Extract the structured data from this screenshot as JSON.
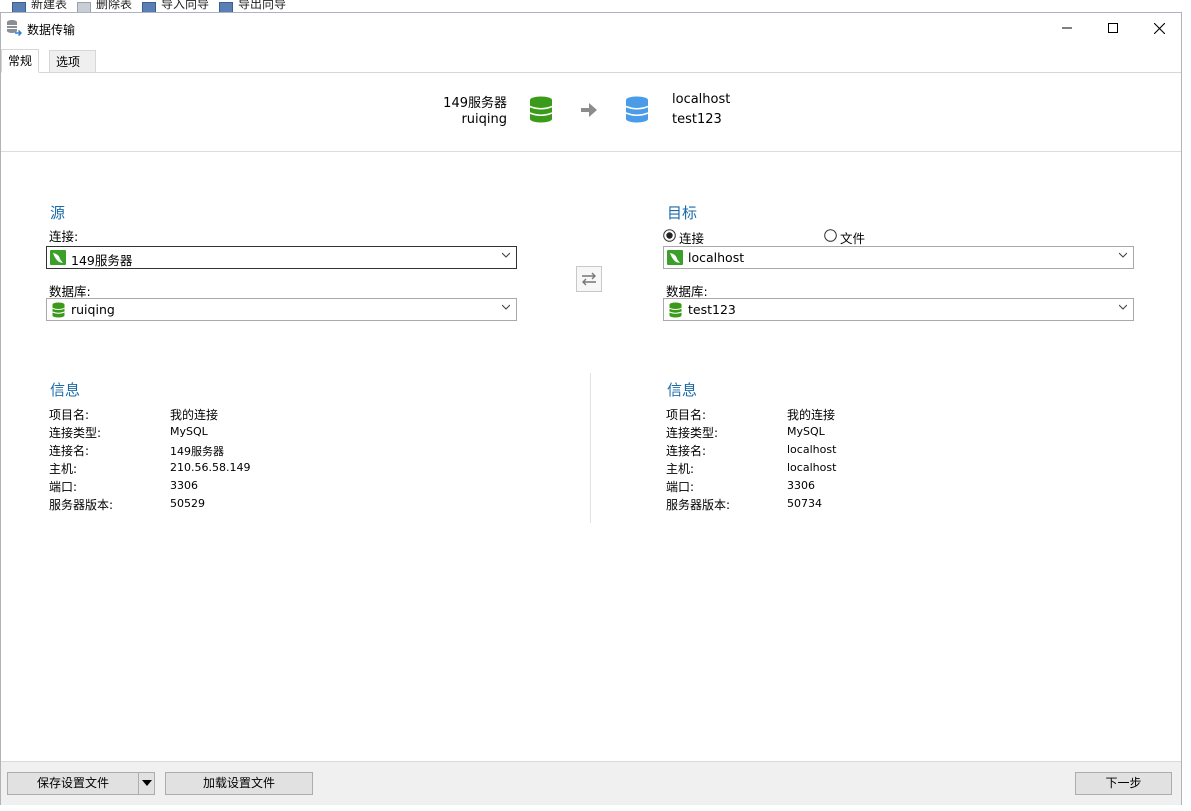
{
  "background_toolbar": {
    "items": [
      "新建表",
      "删除表",
      "导入向导",
      "导出向导"
    ]
  },
  "window": {
    "title": "数据传输",
    "controls": {
      "minimize": "—",
      "maximize": "☐",
      "close": "✕"
    }
  },
  "tabs": [
    {
      "label": "常规",
      "active": true
    },
    {
      "label": "选项",
      "active": false
    }
  ],
  "transfer_summary": {
    "source_connection": "149服务器",
    "source_database": "ruiqing",
    "target_connection": "localhost",
    "target_database": "test123",
    "source_icon": "green-database-icon",
    "target_icon": "blue-database-icon",
    "arrow_icon": "right-arrow-icon"
  },
  "source": {
    "title": "源",
    "connection_label": "连接:",
    "connection_value": "149服务器",
    "database_label": "数据库:",
    "database_value": "ruiqing"
  },
  "target": {
    "title": "目标",
    "radio_connection": "连接",
    "radio_file": "文件",
    "selected_radio": "connection",
    "connection_value": "localhost",
    "database_label": "数据库:",
    "database_value": "test123"
  },
  "swap_button_icon": "swap-arrows-icon",
  "source_info": {
    "title": "信息",
    "rows": [
      {
        "label": "项目名:",
        "value": "我的连接"
      },
      {
        "label": "连接类型:",
        "value": "MySQL"
      },
      {
        "label": "连接名:",
        "value": "149服务器"
      },
      {
        "label": "主机:",
        "value": "210.56.58.149"
      },
      {
        "label": "端口:",
        "value": "3306"
      },
      {
        "label": "服务器版本:",
        "value": "50529"
      }
    ]
  },
  "target_info": {
    "title": "信息",
    "rows": [
      {
        "label": "项目名:",
        "value": "我的连接"
      },
      {
        "label": "连接类型:",
        "value": "MySQL"
      },
      {
        "label": "连接名:",
        "value": "localhost"
      },
      {
        "label": "主机:",
        "value": "localhost"
      },
      {
        "label": "端口:",
        "value": "3306"
      },
      {
        "label": "服务器版本:",
        "value": "50734"
      }
    ]
  },
  "footer": {
    "save_settings": "保存设置文件",
    "load_settings": "加载设置文件",
    "next": "下一步"
  },
  "colors": {
    "accent_title": "#1a6aa8",
    "source_db": "#3a9a1a",
    "target_db": "#4a9be8"
  }
}
